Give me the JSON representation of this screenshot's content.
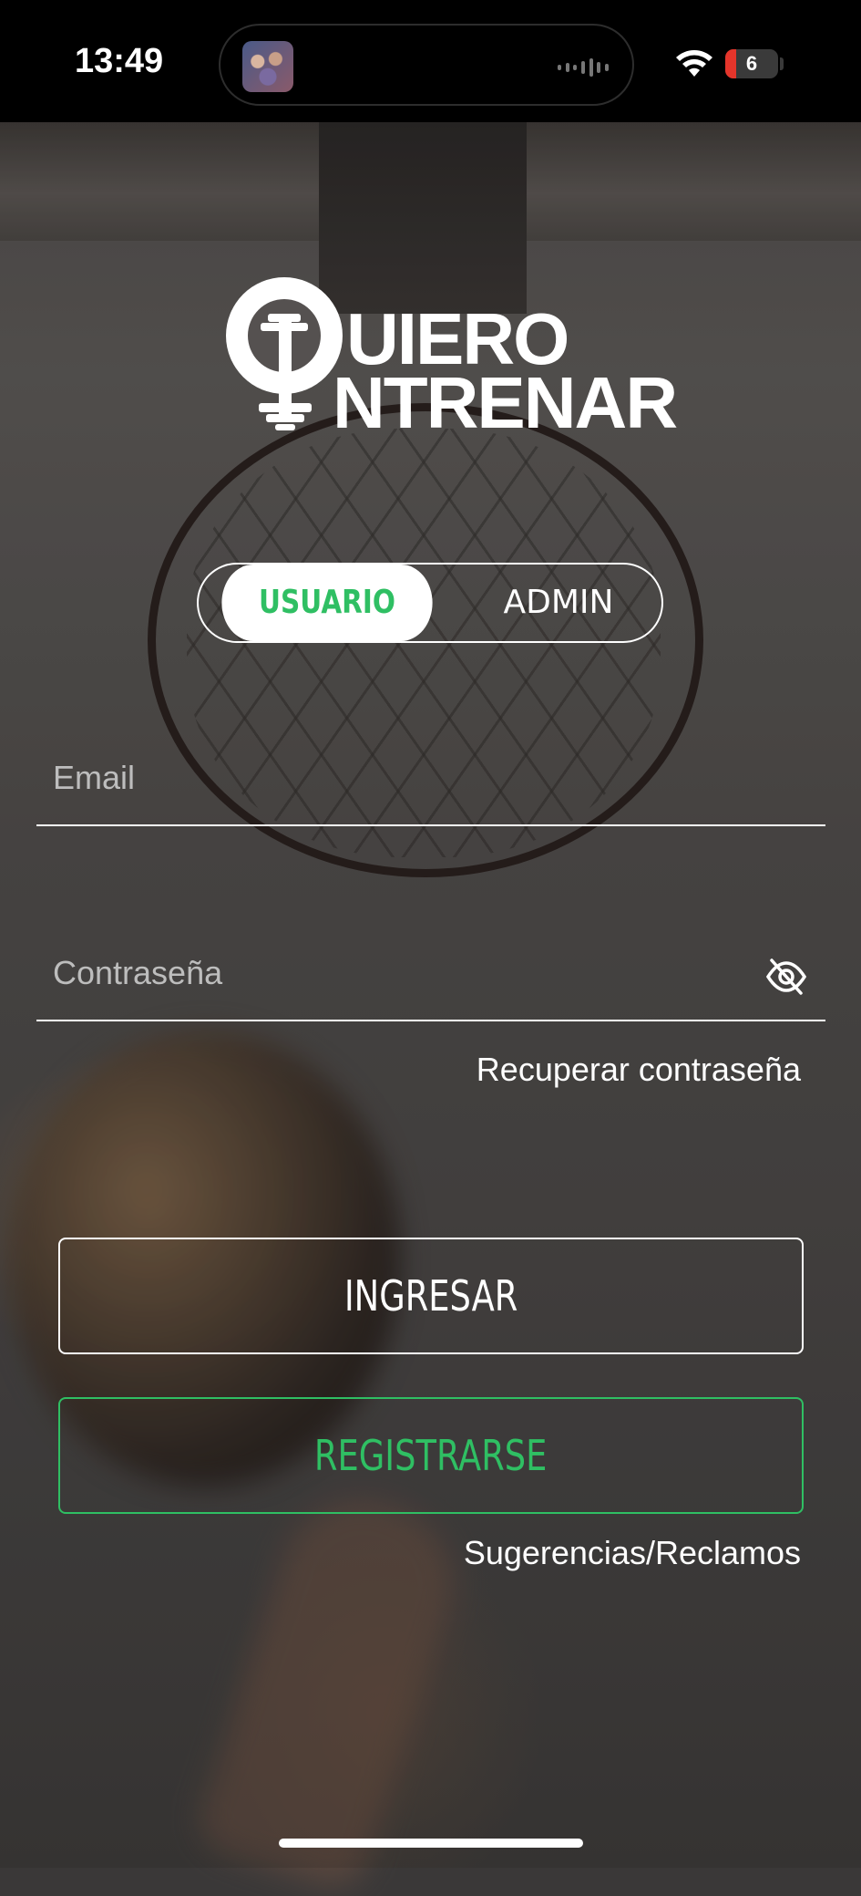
{
  "status_bar": {
    "time": "13:49",
    "battery_level": "6",
    "battery_color": "#e5352b",
    "wifi_icon": "wifi-icon",
    "island_thumbnail_icon": "now-playing-thumbnail",
    "island_wave_icon": "audio-waveform-icon"
  },
  "logo": {
    "line1": "UIERO",
    "line2": "NTRENAR",
    "mark_icon": "dumbbell-q-icon"
  },
  "role_toggle": {
    "options": [
      "USUARIO",
      "ADMIN"
    ],
    "selected": "USUARIO"
  },
  "form": {
    "email_placeholder": "Email",
    "email_value": "",
    "password_placeholder": "Contraseña",
    "password_value": "",
    "password_visibility_icon": "eye-off-icon",
    "recover_link": "Recuperar contraseña"
  },
  "actions": {
    "login_label": "INGRESAR",
    "register_label": "REGISTRARSE"
  },
  "footer": {
    "suggestions_link": "Sugerencias/Reclamos"
  },
  "colors": {
    "accent_green": "#2fbf63",
    "text": "#ffffff"
  }
}
